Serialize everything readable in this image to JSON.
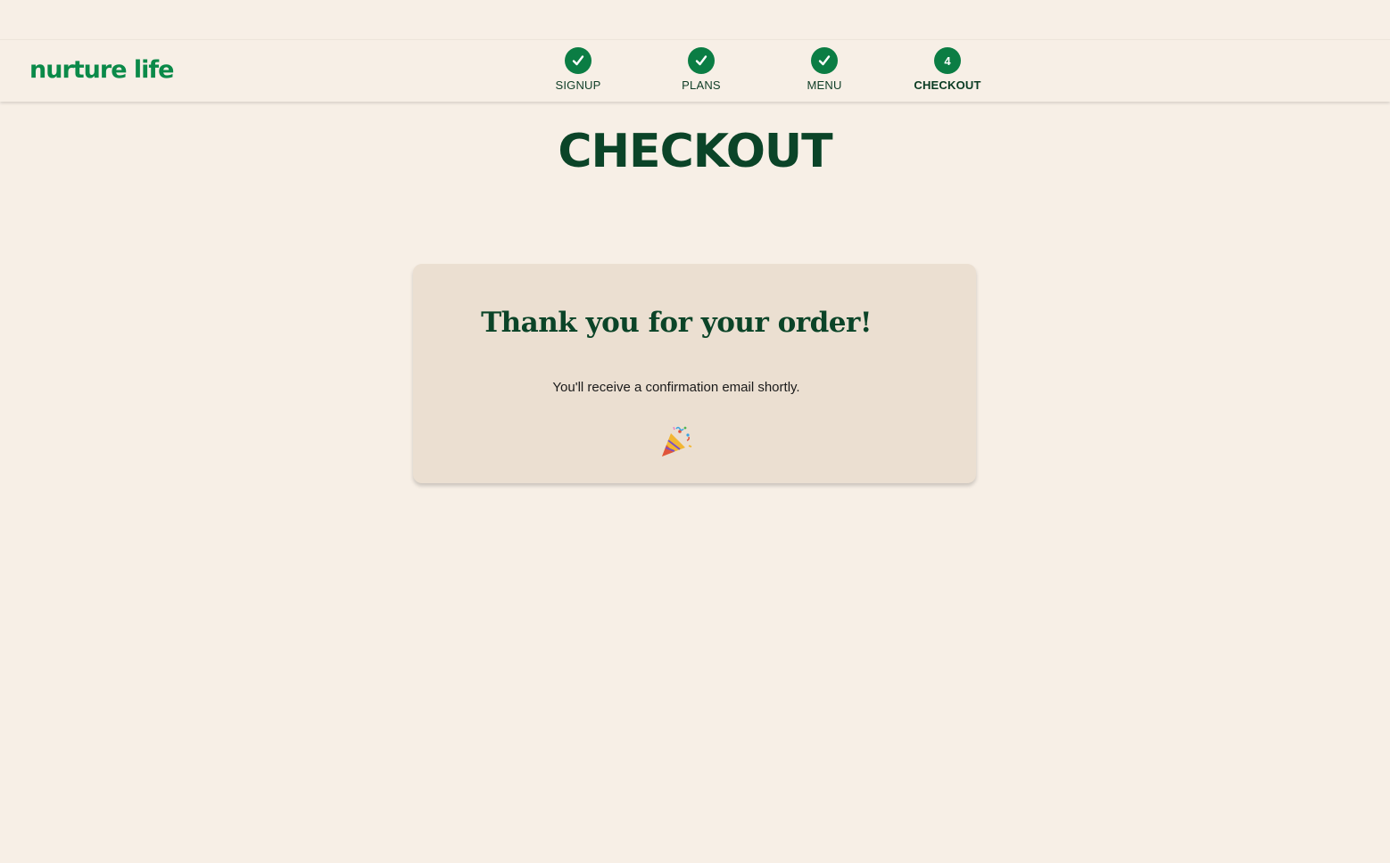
{
  "brand": {
    "name": "nurture life",
    "color": "#0b8a49"
  },
  "steps": [
    {
      "label": "SIGNUP",
      "status": "complete",
      "icon": "checkmark-icon"
    },
    {
      "label": "PLANS",
      "status": "complete",
      "icon": "checkmark-icon"
    },
    {
      "label": "MENU",
      "status": "complete",
      "icon": "checkmark-icon"
    },
    {
      "label": "CHECKOUT",
      "status": "current",
      "number": "4"
    }
  ],
  "page": {
    "title": "CHECKOUT"
  },
  "confirmation": {
    "heading": "Thank you for your order!",
    "message": "You'll receive a confirmation email shortly.",
    "icon": "party-popper-icon"
  },
  "colors": {
    "background": "#f7efe6",
    "card": "#ebdfd1",
    "dark_green": "#0b4428",
    "step_green": "#0b7d44"
  }
}
